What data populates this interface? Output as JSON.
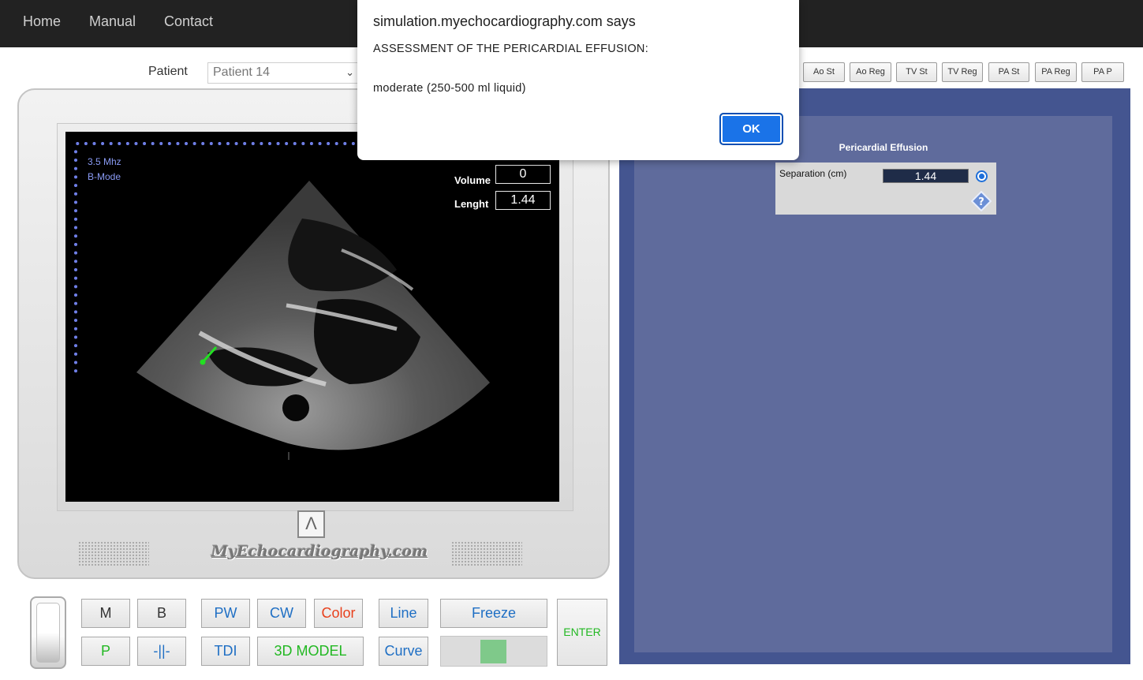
{
  "nav": {
    "home": "Home",
    "manual": "Manual",
    "contact": "Contact"
  },
  "patient": {
    "label": "Patient",
    "selected": "Patient 14"
  },
  "view_buttons": [
    "Ao St",
    "Ao Reg",
    "TV St",
    "TV Reg",
    "PA St",
    "PA Reg",
    "PA P"
  ],
  "screen": {
    "frequency": "3.5 Mhz",
    "mode": "B-Mode",
    "volume_label": "Volume",
    "volume_value": "0",
    "length_label": "Lenght",
    "length_value": "1.44"
  },
  "brand": {
    "text": "MyEchocardiography.com",
    "logo_glyph": "Λ"
  },
  "controls": {
    "m": "M",
    "b": "B",
    "pw": "PW",
    "cw": "CW",
    "color": "Color",
    "line": "Line",
    "freeze": "Freeze",
    "p": "P",
    "split": "-||-",
    "tdi": "TDI",
    "model3d": "3D MODEL",
    "curve": "Curve",
    "enter": "ENTER"
  },
  "colors": {
    "color_button": "#e8401c",
    "blue_button": "#1f6fc4",
    "green_button": "#22b822",
    "panel_outer": "#445590",
    "panel_inner": "#5f6b9c",
    "ok_button": "#1a73e8"
  },
  "panel": {
    "title": "Pericardial Effusion",
    "separation_label": "Separation (cm)",
    "separation_value": "1.44"
  },
  "dialog": {
    "title": "simulation.myechocardiography.com says",
    "message_line1": "ASSESSMENT OF THE PERICARDIAL EFFUSION:",
    "message_line2": "moderate (250-500 ml liquid)",
    "ok": "OK"
  }
}
